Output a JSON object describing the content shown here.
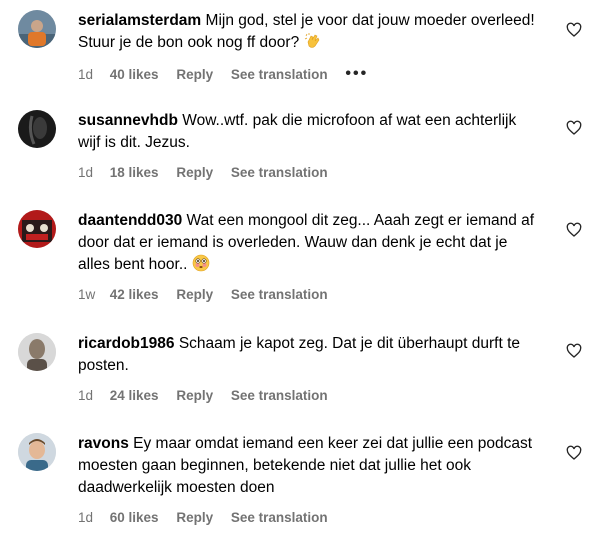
{
  "colors": {
    "text": "#000000",
    "meta_text": "#737373",
    "background": "#ffffff"
  },
  "comments": [
    {
      "username": "serialamsterdam",
      "text": "Mijn god, stel je voor dat jouw moeder overleed! Stuur je de bon ook nog ff door?",
      "emoji": "clapping-hands",
      "age": "1d",
      "likes": "40 likes",
      "reply": "Reply",
      "see_translation": "See translation",
      "more": "•••"
    },
    {
      "username": "susannevhdb",
      "text": "Wow..wtf. pak die microfoon af wat een achterlijk wijf is dit. Jezus.",
      "age": "1d",
      "likes": "18 likes",
      "reply": "Reply",
      "see_translation": "See translation"
    },
    {
      "username": "daantendd030",
      "text": "Wat een mongool dit zeg... Aaah zegt er iemand af door dat er iemand is overleden. Wauw dan denk je echt dat je alles bent hoor..",
      "emoji": "flushed-face",
      "age": "1w",
      "likes": "42 likes",
      "reply": "Reply",
      "see_translation": "See translation"
    },
    {
      "username": "ricardob1986",
      "text": "Schaam je kapot zeg. Dat je dit überhaupt durft te posten.",
      "age": "1d",
      "likes": "24 likes",
      "reply": "Reply",
      "see_translation": "See translation"
    },
    {
      "username": "ravons",
      "text": "Ey maar omdat iemand een keer zei dat jullie een podcast moesten gaan beginnen, betekende niet dat jullie het ook daadwerkelijk moesten doen",
      "age": "1d",
      "likes": "60 likes",
      "reply": "Reply",
      "see_translation": "See translation"
    }
  ]
}
